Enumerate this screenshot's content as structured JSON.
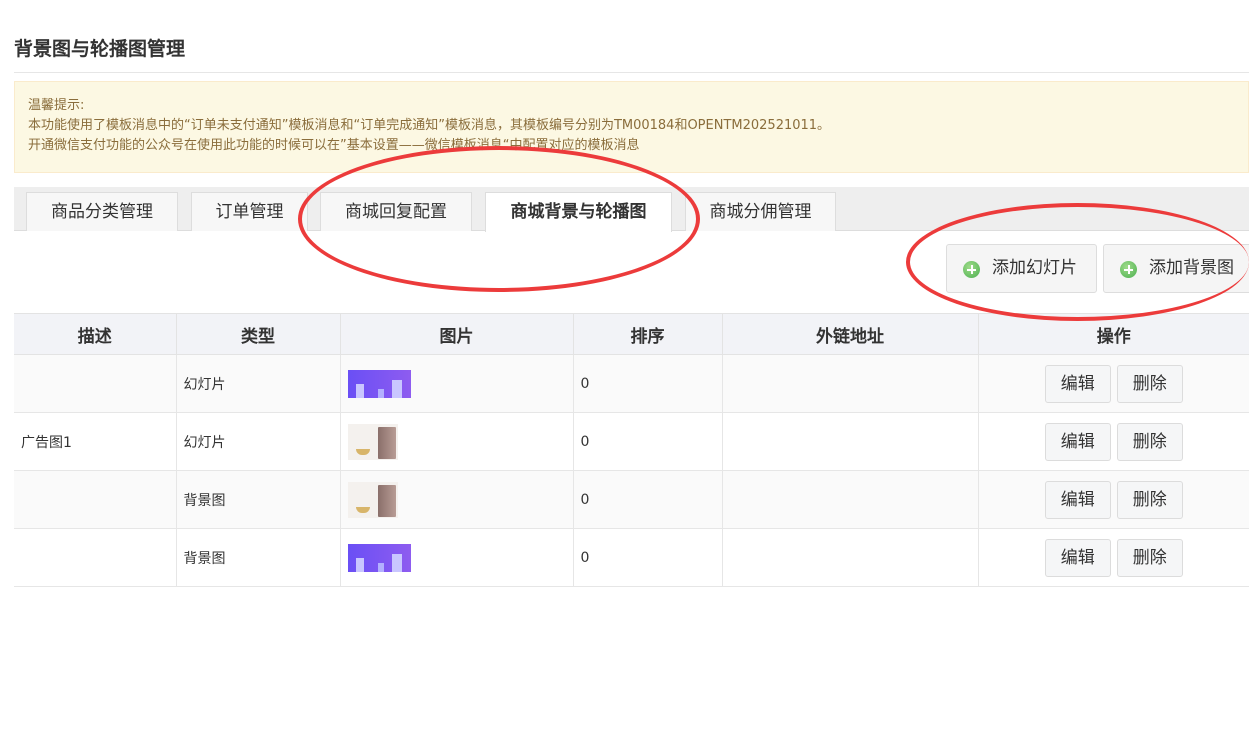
{
  "page": {
    "title": "背景图与轮播图管理"
  },
  "notice": {
    "lines": [
      "温馨提示:",
      "本功能使用了模板消息中的“订单未支付通知”模板消息和“订单完成通知”模板消息，其模板编号分别为TM00184和OPENTM202521011。",
      "开通微信支付功能的公众号在使用此功能的时候可以在”基本设置——微信模板消息“中配置对应的模板消息"
    ]
  },
  "tabs": [
    {
      "label": "商品分类管理"
    },
    {
      "label": "订单管理"
    },
    {
      "label": "商城回复配置"
    },
    {
      "label": "商城背景与轮播图"
    },
    {
      "label": "商城分佣管理"
    }
  ],
  "actions": {
    "add_slide": "添加幻灯片",
    "add_background": "添加背景图"
  },
  "table": {
    "headers": [
      "描述",
      "类型",
      "图片",
      "排序",
      "外链地址",
      "操作"
    ],
    "rows": [
      {
        "desc": "",
        "type": "幻灯片",
        "image": "city-banner",
        "sort": "0",
        "link": ""
      },
      {
        "desc": "广告图1",
        "type": "幻灯片",
        "image": "fridge-photo",
        "sort": "0",
        "link": ""
      },
      {
        "desc": "",
        "type": "背景图",
        "image": "fridge-photo",
        "sort": "0",
        "link": ""
      },
      {
        "desc": "",
        "type": "背景图",
        "image": "city-banner",
        "sort": "0",
        "link": ""
      }
    ],
    "edit_label": "编辑",
    "delete_label": "删除"
  },
  "colors": {
    "annotation": "#ec3b3b",
    "notice_bg": "#fcf8e3",
    "notice_text": "#8a6d3b",
    "add_icon": "#4caf50"
  }
}
